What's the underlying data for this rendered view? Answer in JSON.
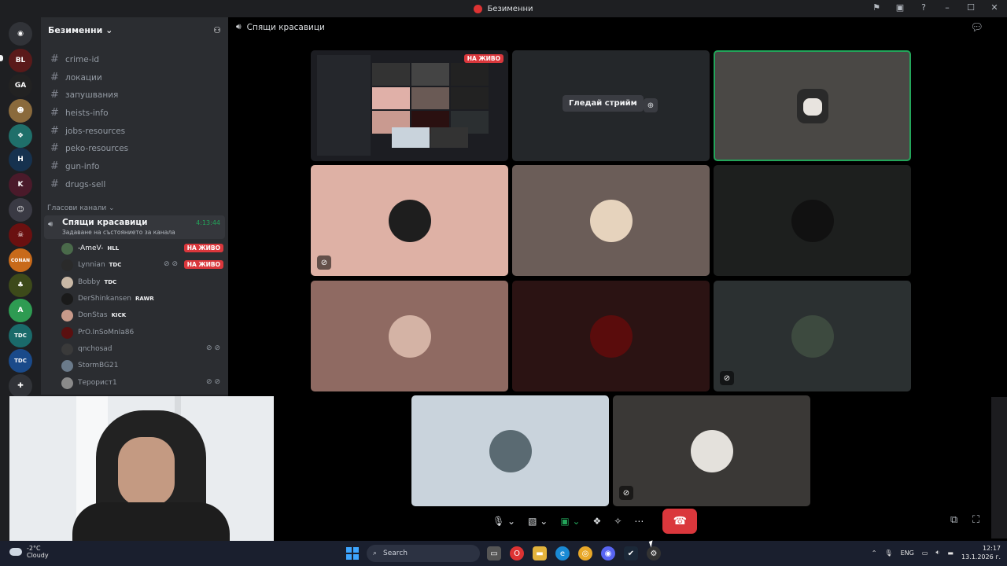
{
  "window": {
    "title": "Безименни"
  },
  "server": {
    "name": "Безименни",
    "text_channels": [
      "crime-id",
      "локации",
      "запушвания",
      "heists-info",
      "jobs-resources",
      "peko-resources",
      "gun-info",
      "drugs-sell"
    ],
    "voice_category": "Гласови канали",
    "voice_channel": {
      "name": "Спящи красавици",
      "status": "Задаване на състоянието за канала",
      "time": "4:13:44"
    },
    "voice_users": [
      {
        "name": "-AmeV-",
        "tag": "HLL",
        "live": "НА ЖИВО"
      },
      {
        "name": "Lynnian",
        "tag": "TDC",
        "live": "НА ЖИВО"
      },
      {
        "name": "Bobby",
        "tag": "TDC"
      },
      {
        "name": "DerShinkansen",
        "tag": "RAWR"
      },
      {
        "name": "DonStas",
        "tag": "KICK"
      },
      {
        "name": "PrO.InSoMnIa86"
      },
      {
        "name": "qnchosad"
      },
      {
        "name": "StormBG21"
      },
      {
        "name": "Терорист1"
      }
    ]
  },
  "call": {
    "channel_title": "Спящи красавици",
    "live_badge": "НА ЖИВО",
    "watch_stream": "Гледай стрийм"
  },
  "taskbar": {
    "weather_temp": "-2°C",
    "weather_desc": "Cloudy",
    "search": "Search",
    "lang": "ENG",
    "time": "12:17",
    "date": "13.1.2026 г."
  },
  "colors": {
    "accent": "#23a55a",
    "danger": "#da373c",
    "bg": "#000000",
    "sidebar": "#2b2d31"
  }
}
